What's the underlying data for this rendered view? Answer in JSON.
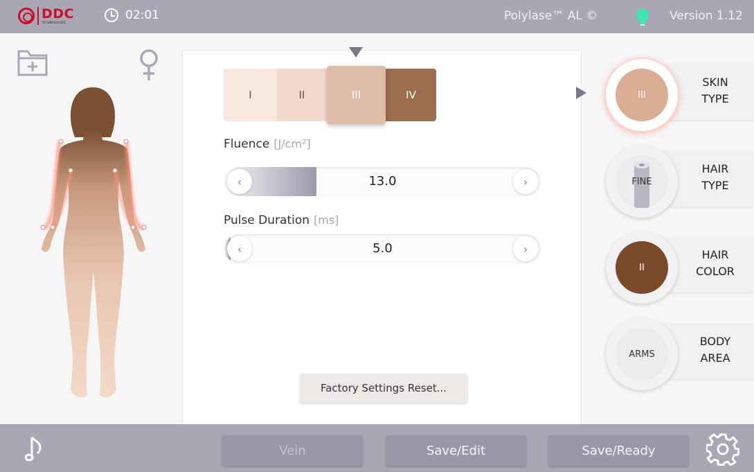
{
  "header": {
    "logo_text": "DDC",
    "logo_sub": "TECHNOLOGIES",
    "time": "02:01",
    "product": "Polylase™ AL ©",
    "version": "Version 1.12",
    "status_light_color": "#3ee6b4"
  },
  "patient": {
    "gender_icon": "female-icon",
    "folder_icon": "folder-add-icon"
  },
  "skin_type_selector": {
    "tabs": [
      "I",
      "II",
      "III",
      "IV"
    ],
    "selected": "III",
    "colors": [
      "#f8e8df",
      "#f3d9cb",
      "#dfbca8",
      "#9b6f4d"
    ]
  },
  "fluence": {
    "label": "Fluence",
    "unit": "[J/cm²]",
    "value": "13.0",
    "fill_fraction": 0.29
  },
  "pulse_duration": {
    "label": "Pulse Duration",
    "unit": "[ms]",
    "value": "5.0",
    "fill_fraction": 0.02
  },
  "factory_reset_label": "Factory Settings Reset...",
  "cards": {
    "skin_type": {
      "value": "III",
      "label_1": "SKIN",
      "label_2": "TYPE",
      "color": "#d9ae94"
    },
    "hair_type": {
      "value": "FINE",
      "label_1": "HAIR",
      "label_2": "TYPE"
    },
    "hair_color": {
      "value": "II",
      "label_1": "HAIR",
      "label_2": "COLOR",
      "color": "#7a4a2a"
    },
    "body_area": {
      "value": "ARMS",
      "label_1": "BODY",
      "label_2": "AREA"
    }
  },
  "footer": {
    "vein_label": "Vein",
    "save_edit_label": "Save/Edit",
    "save_ready_label": "Save/Ready"
  }
}
